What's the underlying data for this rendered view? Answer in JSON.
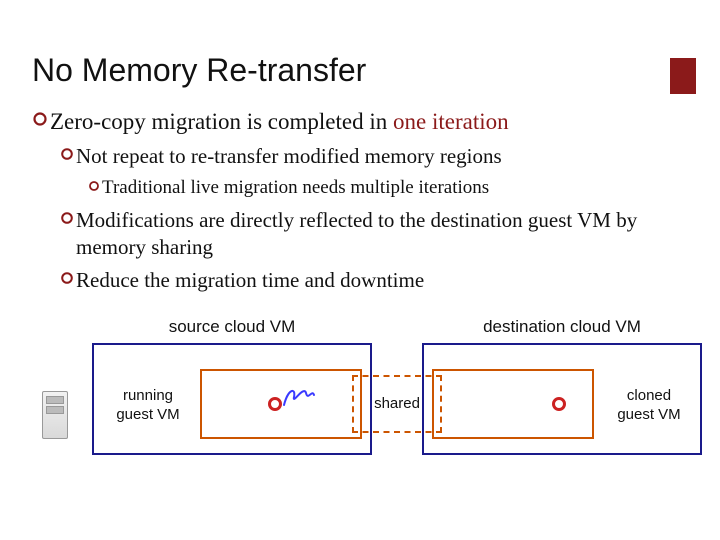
{
  "accent_color": "#8b1a1a",
  "title": "No Memory Re-transfer",
  "bullets": {
    "b1_pre": "Zero-copy migration is completed in ",
    "b1_accent": "one iteration",
    "b2": "Not repeat to re-transfer modified memory regions",
    "b3": "Traditional live migration needs multiple iterations",
    "b4": "Modifications are directly reflected to the destination guest VM by memory sharing",
    "b5": "Reduce the migration time and downtime"
  },
  "diagram": {
    "source_label": "source cloud VM",
    "dest_label": "destination cloud VM",
    "running_label": "running\nguest VM",
    "cloned_label": "cloned\nguest VM",
    "shared_label": "shared"
  }
}
